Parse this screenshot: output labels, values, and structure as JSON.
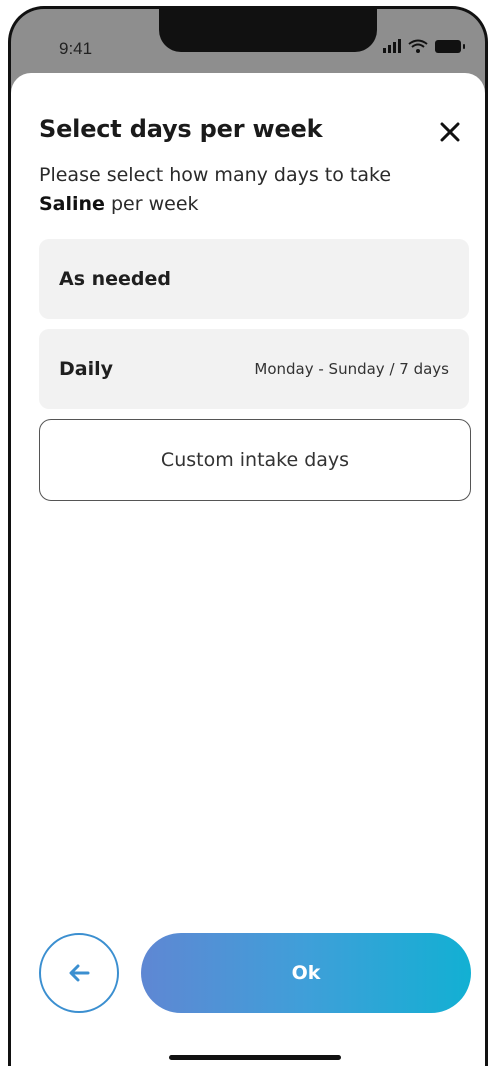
{
  "status_bar": {
    "time": "9:41",
    "icons": [
      "signal-icon",
      "wifi-icon",
      "battery-icon"
    ]
  },
  "sheet": {
    "title": "Select days per week",
    "close_icon": "close-icon",
    "subtitle_prefix": "Please select how many days to take",
    "medication": "Saline",
    "subtitle_suffix": "per week"
  },
  "options": {
    "as_needed": {
      "label": "As needed"
    },
    "daily": {
      "label": "Daily",
      "detail": "Monday - Sunday / 7 days"
    },
    "custom": {
      "label": "Custom intake days"
    }
  },
  "actions": {
    "back_icon": "arrow-left-icon",
    "ok_label": "Ok"
  },
  "colors": {
    "accent_blue": "#3b8fd0",
    "gradient_start": "#5f87d3",
    "gradient_end": "#12b0d3",
    "option_background": "#f2f2f2"
  }
}
